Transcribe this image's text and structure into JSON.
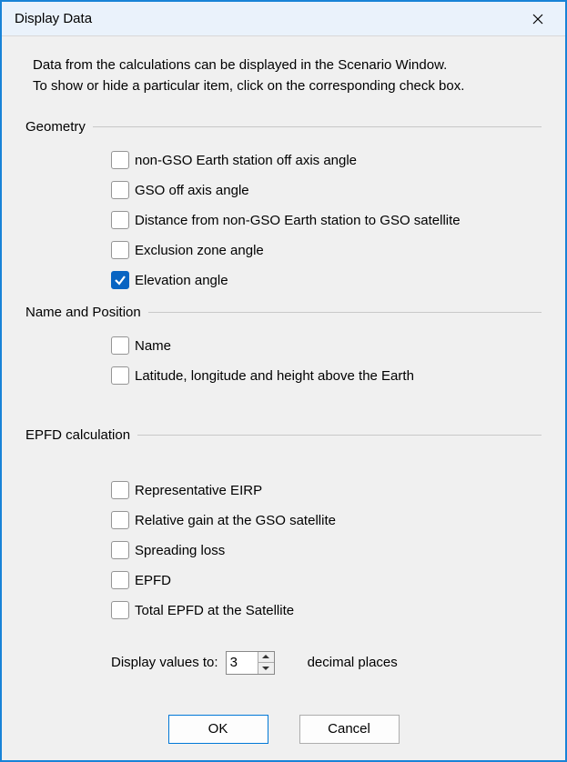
{
  "title": "Display Data",
  "intro": {
    "line1": "Data from the calculations can be displayed in the Scenario Window.",
    "line2": "To show or hide a particular item, click on the corresponding check box."
  },
  "groups": {
    "geometry": {
      "label": "Geometry",
      "items": [
        {
          "label": "non-GSO Earth station off axis angle",
          "checked": false
        },
        {
          "label": "GSO off axis angle",
          "checked": false
        },
        {
          "label": "Distance from non-GSO Earth station to GSO satellite",
          "checked": false
        },
        {
          "label": "Exclusion zone angle",
          "checked": false
        },
        {
          "label": "Elevation angle",
          "checked": true
        }
      ]
    },
    "name_position": {
      "label": "Name and Position",
      "items": [
        {
          "label": "Name",
          "checked": false
        },
        {
          "label": "Latitude, longitude and height above the Earth",
          "checked": false
        }
      ]
    },
    "epfd": {
      "label": "EPFD calculation",
      "items": [
        {
          "label": "Representative EIRP",
          "checked": false
        },
        {
          "label": "Relative gain at the GSO satellite",
          "checked": false
        },
        {
          "label": "Spreading loss",
          "checked": false
        },
        {
          "label": "EPFD",
          "checked": false
        },
        {
          "label": "Total EPFD at the Satellite",
          "checked": false
        }
      ]
    }
  },
  "decimal": {
    "prefix": "Display values to:",
    "value": "3",
    "suffix": "decimal places"
  },
  "buttons": {
    "ok": "OK",
    "cancel": "Cancel"
  }
}
